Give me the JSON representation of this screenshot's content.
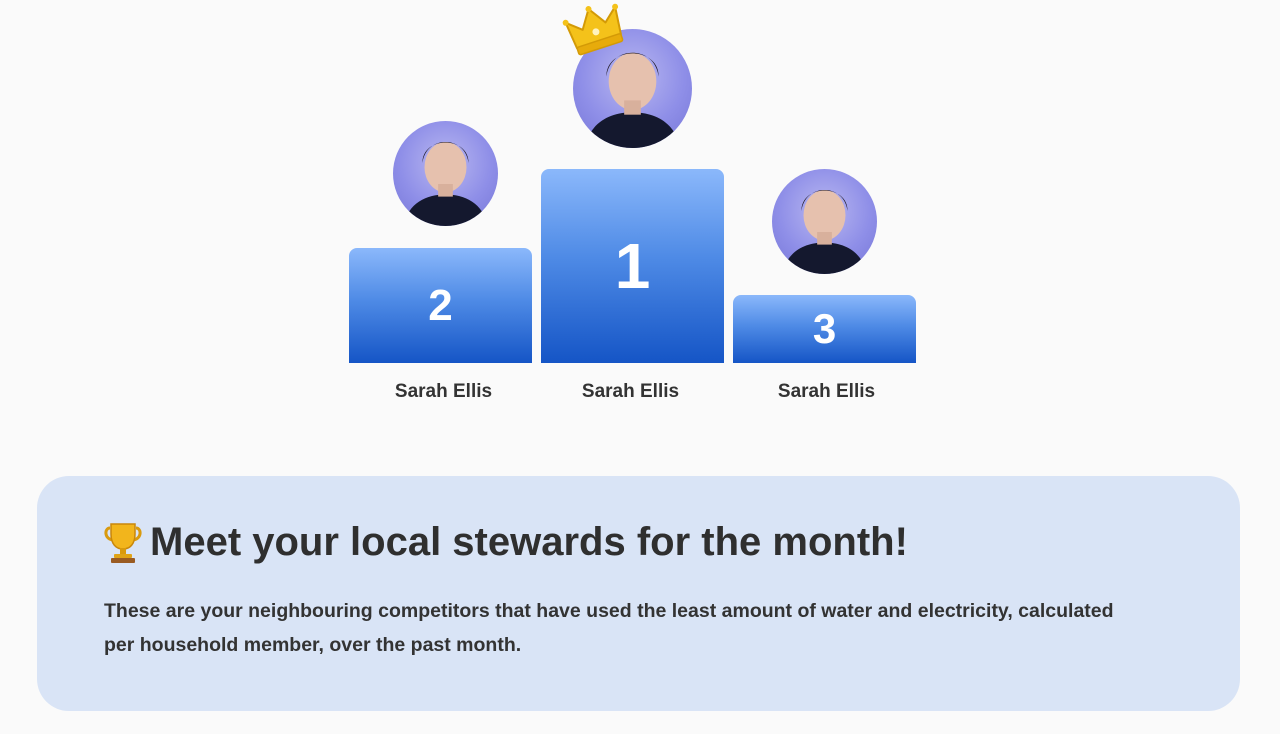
{
  "podium": {
    "first": {
      "rank": "1",
      "name": "Sarah Ellis"
    },
    "second": {
      "rank": "2",
      "name": "Sarah Ellis"
    },
    "third": {
      "rank": "3",
      "name": "Sarah Ellis"
    }
  },
  "info": {
    "title": "Meet your local stewards for the month!",
    "description": "These are your neighbouring competitors that have used the least amount of water and electricity, calculated per household member, over the past month."
  },
  "colors": {
    "page_background": "#fafafa",
    "card_background": "#d9e4f6",
    "podium_top": "#8bb8fb",
    "podium_bottom": "#1555c6",
    "text": "#333333"
  },
  "icons": {
    "crown": "crown-icon",
    "trophy": "trophy-icon"
  }
}
